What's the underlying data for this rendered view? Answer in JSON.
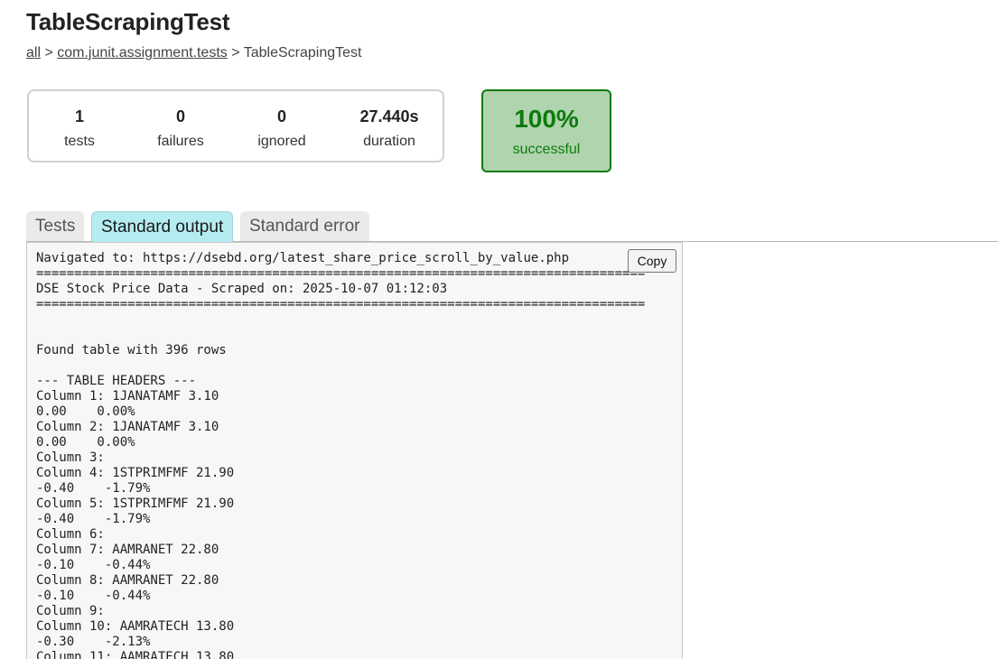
{
  "page_title": "TableScrapingTest",
  "breadcrumbs": {
    "all": "all",
    "sep1": " > ",
    "package": "com.junit.assignment.tests",
    "sep2": " > ",
    "current": "TableScrapingTest"
  },
  "summary": {
    "tests": {
      "value": "1",
      "label": "tests"
    },
    "failures": {
      "value": "0",
      "label": "failures"
    },
    "ignored": {
      "value": "0",
      "label": "ignored"
    },
    "duration": {
      "value": "27.440s",
      "label": "duration"
    }
  },
  "success": {
    "percent": "100%",
    "label": "successful"
  },
  "tabs": [
    {
      "label": "Tests",
      "active": false
    },
    {
      "label": "Standard output",
      "active": true
    },
    {
      "label": "Standard error",
      "active": false
    }
  ],
  "copy_label": "Copy",
  "output_text": "Navigated to: https://dsebd.org/latest_share_price_scroll_by_value.php\n================================================================================\nDSE Stock Price Data - Scraped on: 2025-10-07 01:12:03\n================================================================================\n\n\nFound table with 396 rows\n\n--- TABLE HEADERS ---\nColumn 1: 1JANATAMF 3.10\n0.00    0.00%\nColumn 2: 1JANATAMF 3.10\n0.00    0.00%\nColumn 3:\nColumn 4: 1STPRIMFMF 21.90\n-0.40    -1.79%\nColumn 5: 1STPRIMFMF 21.90\n-0.40    -1.79%\nColumn 6:\nColumn 7: AAMRANET 22.80\n-0.10    -0.44%\nColumn 8: AAMRANET 22.80\n-0.10    -0.44%\nColumn 9:\nColumn 10: AAMRATECH 13.80\n-0.30    -2.13%\nColumn 11: AAMRATECH 13.80",
  "colors": {
    "success_bg": "#b0d5ae",
    "success_text": "#0e7a0e",
    "active_tab_bg": "#b4ecf1"
  }
}
